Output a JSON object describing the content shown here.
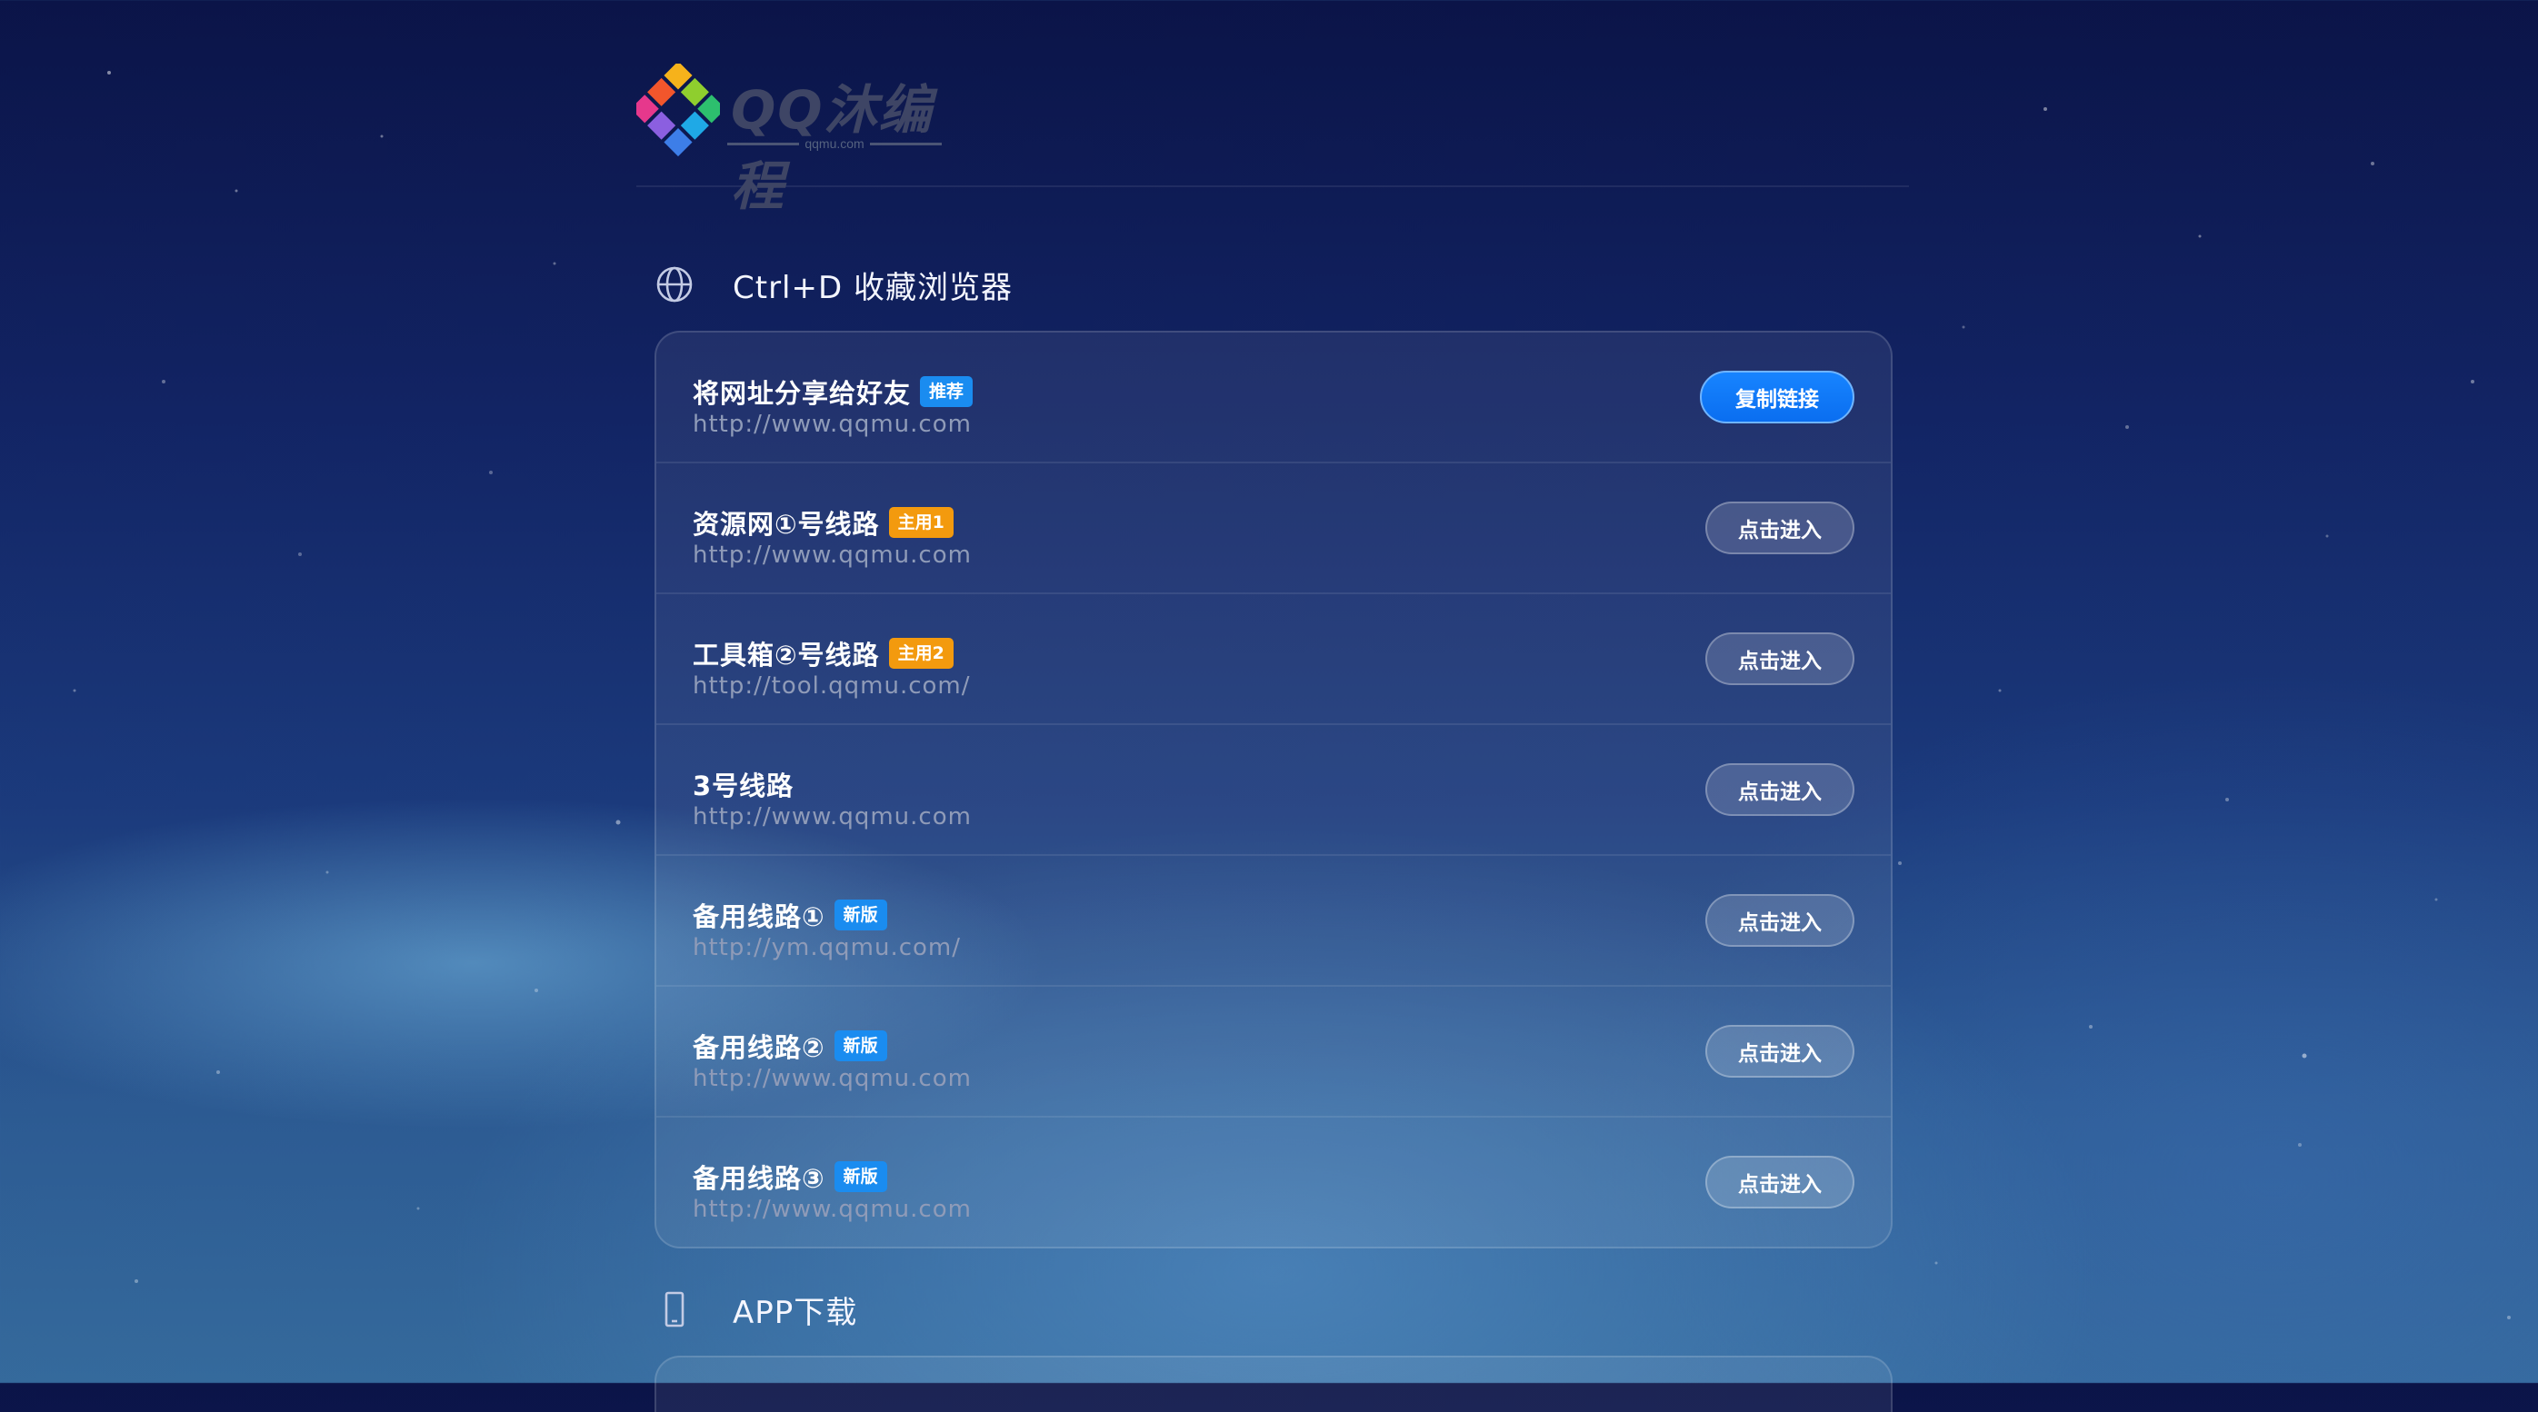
{
  "brand": {
    "name": "QQ沐编程",
    "domain": "qqmu.com"
  },
  "sections": [
    {
      "title": "Ctrl+D 收藏浏览器",
      "icon": "globe-icon"
    },
    {
      "title": "APP下载",
      "icon": "mobile-phone-icon"
    }
  ],
  "links": [
    {
      "name": "将网址分享给好友",
      "badge": "推荐",
      "badge_color": "#1a8cf0",
      "url": "http://www.qqmu.com",
      "button": "复制链接"
    },
    {
      "name": "资源网①号线路",
      "badge": "主用1",
      "badge_color": "#f39a0e",
      "url": "http://www.qqmu.com",
      "button": "点击进入"
    },
    {
      "name": "工具箱②号线路",
      "badge": "主用2",
      "badge_color": "#f39a0e",
      "url": "http://tool.qqmu.com/",
      "button": "点击进入"
    },
    {
      "name": "3号线路",
      "badge": "",
      "url": "http://www.qqmu.com",
      "button": "点击进入"
    },
    {
      "name": "备用线路①",
      "badge": "新版",
      "badge_color": "#1a8cf0",
      "url": "http://ym.qqmu.com/",
      "button": "点击进入"
    },
    {
      "name": "备用线路②",
      "badge": "新版",
      "badge_color": "#1a8cf0",
      "url": "http://www.qqmu.com",
      "button": "点击进入"
    },
    {
      "name": "备用线路③",
      "badge": "新版",
      "badge_color": "#1a8cf0",
      "url": "http://www.qqmu.com",
      "button": "点击进入"
    }
  ]
}
